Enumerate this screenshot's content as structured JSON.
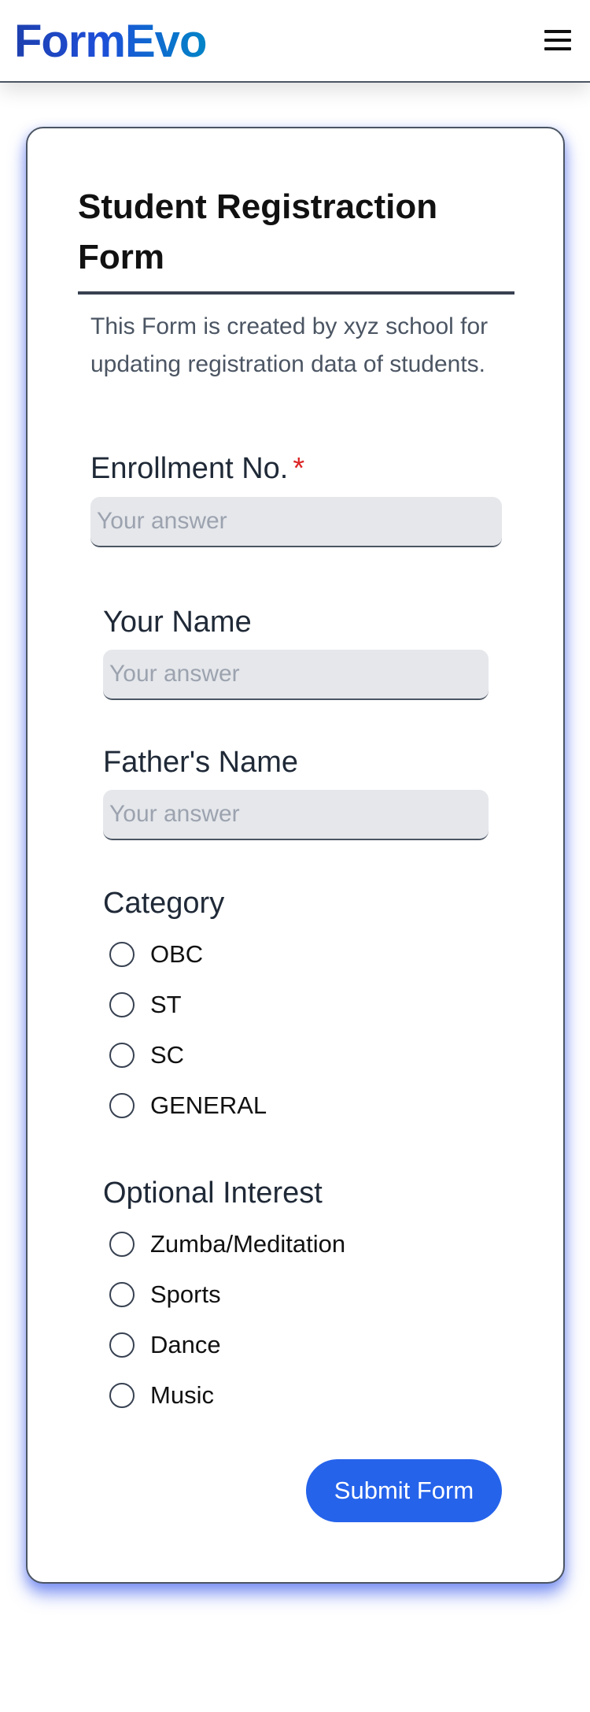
{
  "header": {
    "logo": "FormEvo",
    "menu_icon": "hamburger-menu-icon"
  },
  "form": {
    "title": "Student Registraction Form",
    "description": "This Form is created by xyz school for updating registration data of students.",
    "enrollment": {
      "label": "Enrollment No.",
      "required_mark": "*",
      "placeholder": "Your answer"
    },
    "your_name": {
      "label": "Your Name",
      "placeholder": "Your answer"
    },
    "fathers_name": {
      "label": "Father's Name",
      "placeholder": "Your answer"
    },
    "category": {
      "label": "Category",
      "options": [
        "OBC",
        "ST",
        "SC",
        "GENERAL"
      ]
    },
    "optional_interest": {
      "label": "Optional Interest",
      "options": [
        "Zumba/Meditation",
        "Sports",
        "Dance",
        "Music"
      ]
    },
    "submit_label": "Submit Form"
  },
  "colors": {
    "accent": "#2563eb",
    "required": "#dc2626",
    "card_glow": "#3b5beb"
  }
}
